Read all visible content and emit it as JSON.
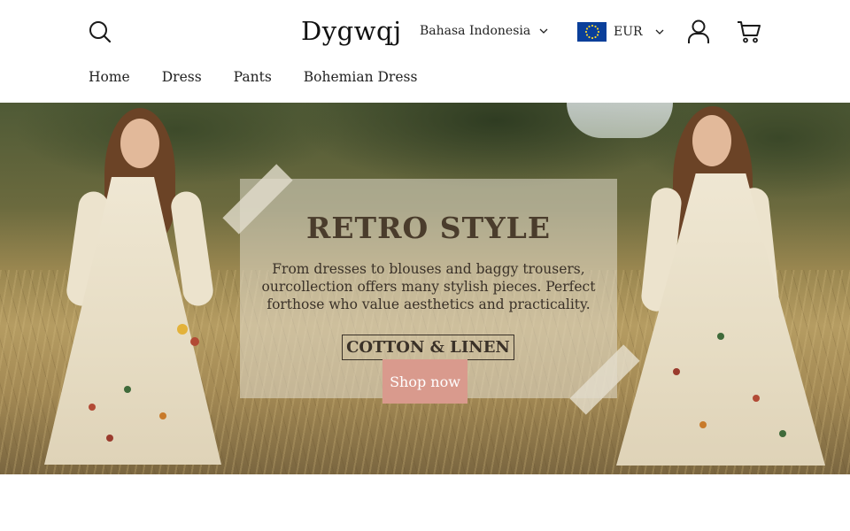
{
  "header": {
    "logo": "Dygwqj",
    "language": "Bahasa Indonesia",
    "currency": "EUR"
  },
  "nav": [
    "Home",
    "Dress",
    "Pants",
    "Bohemian Dress"
  ],
  "hero": {
    "title": "RETRO STYLE",
    "text": "From dresses to blouses and baggy trousers, ourcollection offers many stylish pieces. Perfect forthose who value aesthetics and practicality.",
    "badge": "COTTON & LINEN",
    "cta": "Shop now"
  },
  "icons": [
    "search-icon",
    "chevron-down-icon",
    "eu-flag-icon",
    "user-icon",
    "cart-icon"
  ],
  "colors": {
    "cta_background": "#d99a8d",
    "flag_blue": "#0a3f9a",
    "text": "#1a1a1a"
  }
}
